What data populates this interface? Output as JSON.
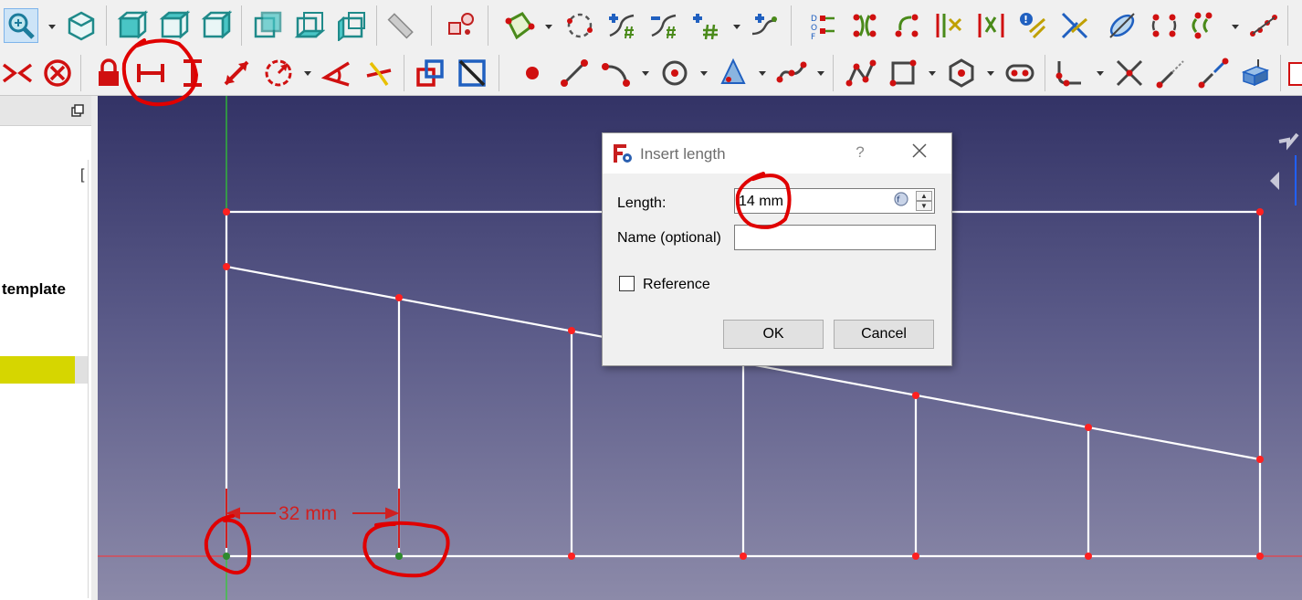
{
  "toolbar_top": {
    "icons": [
      "zoom-icon",
      "view-isometric-icon",
      "view-front-icon",
      "view-top-icon",
      "view-right-icon",
      "view-rear-icon",
      "view-bottom-icon",
      "view-left-icon",
      "measure-icon",
      "map-sketch-icon",
      "validate-sketch-icon",
      "close-shape-icon",
      "connect-edges-icon",
      "select-constraints-icon",
      "select-origin-icon",
      "select-elements-icon",
      "select-associated-icon",
      "show-dof-icon",
      "redundant-constraints-icon",
      "conflicting-constraints-icon",
      "select-constraints-2-icon",
      "elements-constraints-icon",
      "select-vertical-axis-icon",
      "select-horizontal-axis-icon",
      "symmetry-icon",
      "clone-icon",
      "copy-icon",
      "rectangular-array-icon"
    ]
  },
  "toolbar_bottom": {
    "icons": [
      "constraint-symmetric-icon",
      "constraint-block-icon",
      "constraint-lock-icon",
      "constraint-horizontal-distance-icon",
      "constraint-vertical-distance-icon",
      "constraint-distance-icon",
      "constraint-radius-icon",
      "constraint-angle-icon",
      "constraint-snell-icon",
      "toggle-driving-icon",
      "toggle-active-icon",
      "create-point-icon",
      "create-line-icon",
      "create-arc-icon",
      "create-circle-icon",
      "create-conic-icon",
      "create-bspline-icon",
      "create-polyline-icon",
      "create-rectangle-icon",
      "create-polygon-icon",
      "create-slot-icon",
      "fillet-icon",
      "trim-icon",
      "extend-icon",
      "external-geometry-icon",
      "carbon-copy-icon"
    ]
  },
  "left_panel": {
    "tree_item_partial": "template",
    "bracket_glyph": "["
  },
  "viewport": {
    "dimension_label": "32 mm",
    "dimension_value_mm": 32
  },
  "dialog": {
    "title": "Insert length",
    "help_glyph": "?",
    "length_label": "Length:",
    "length_value": "14 mm",
    "name_label": "Name (optional)",
    "name_value": "",
    "reference_label": "Reference",
    "reference_checked": false,
    "ok_label": "OK",
    "cancel_label": "Cancel"
  },
  "colors": {
    "viewport_top": "#333366",
    "viewport_bottom": "#8c8aa9",
    "sketch_line": "#ffffff",
    "sketch_point": "#ff2020",
    "constraint_red": "#d02020",
    "highlight_yellow": "#d6d600",
    "annotation_red": "#e00000"
  }
}
